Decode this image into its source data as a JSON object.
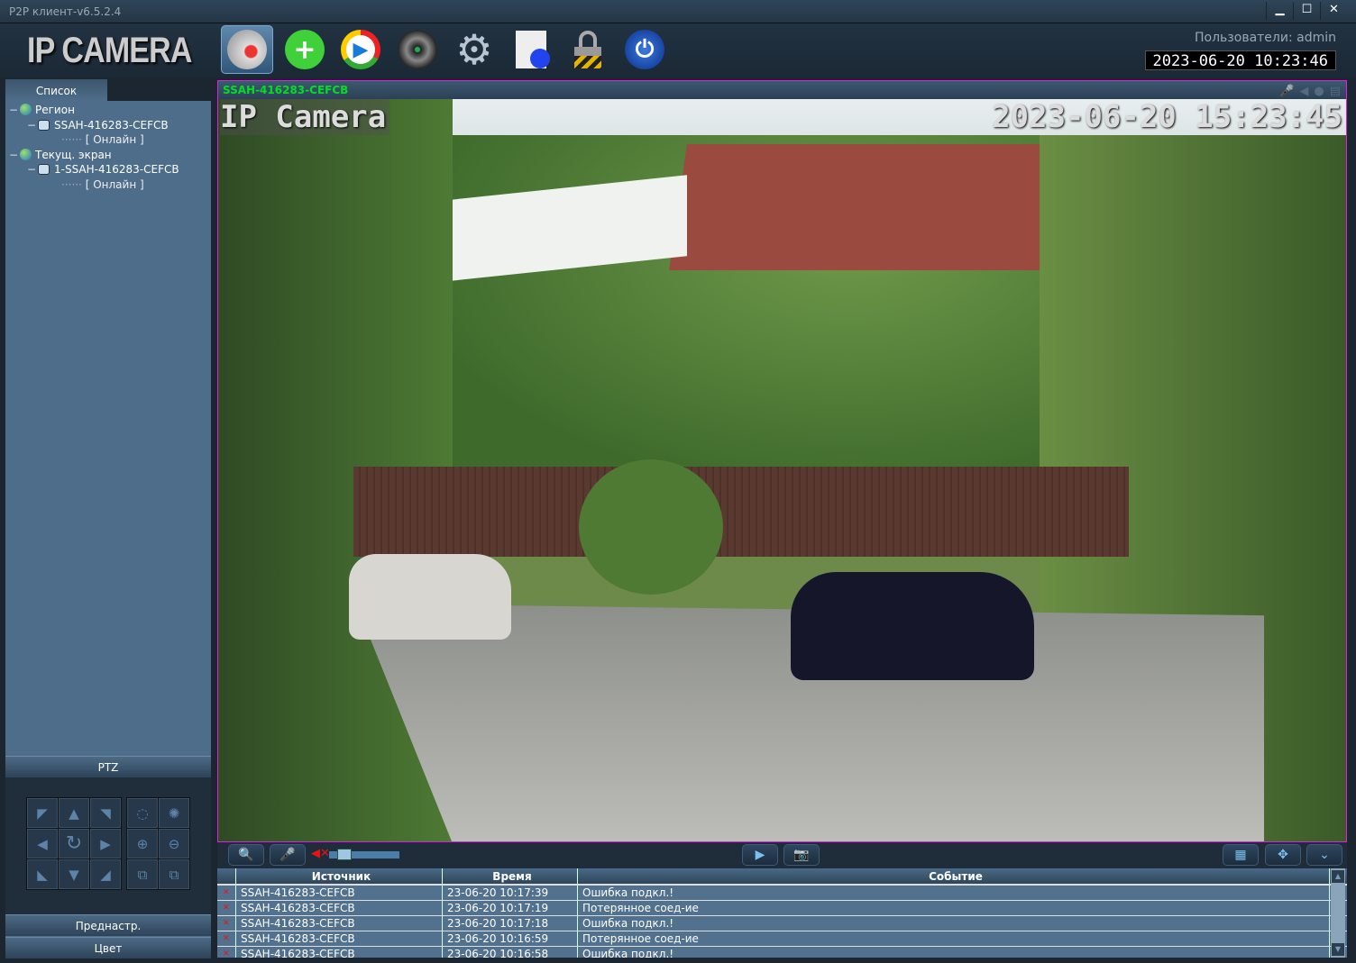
{
  "window": {
    "title": "P2P клиент-v6.5.2.4",
    "controls": [
      "▁",
      "☐",
      "✕"
    ]
  },
  "toolbar": {
    "logo": "IP CAMERA",
    "buttons": [
      {
        "name": "live-view",
        "icon": "webcam-icon"
      },
      {
        "name": "add-device",
        "icon": "plus-icon"
      },
      {
        "name": "playback",
        "icon": "play-icon"
      },
      {
        "name": "ptz-control",
        "icon": "reel-icon"
      },
      {
        "name": "settings",
        "icon": "gear-icon"
      },
      {
        "name": "log",
        "icon": "document-icon"
      },
      {
        "name": "lock",
        "icon": "lock-icon"
      },
      {
        "name": "exit",
        "icon": "power-icon"
      }
    ],
    "user": "Пользователи: admin",
    "clock": "2023-06-20  10:23:46"
  },
  "sidebar": {
    "tab": "Список",
    "tree": [
      {
        "label": "Регион",
        "children": [
          {
            "label": "SSAH-416283-CEFCB",
            "status": "[   Онлайн   ]"
          }
        ]
      },
      {
        "label": "Текущ. экран",
        "children": [
          {
            "label": "1-SSAH-416283-CEFCB",
            "status": "[   Онлайн   ]"
          }
        ]
      }
    ],
    "ptz_label": "PTZ",
    "preset_label": "Преднастр.",
    "color_label": "Цвет"
  },
  "video": {
    "channel": "SSAH-416283-CEFCB",
    "osd_name": "IP Camera",
    "osd_time": "2023-06-20 15:23:45",
    "volume": 0.15
  },
  "events": {
    "columns": [
      "Источник",
      "Время",
      "Событие"
    ],
    "rows": [
      [
        "SSAH-416283-CEFCB",
        "23-06-20 10:17:39",
        "Ошибка подкл.!"
      ],
      [
        "SSAH-416283-CEFCB",
        "23-06-20 10:17:19",
        "Потерянное соед-ие"
      ],
      [
        "SSAH-416283-CEFCB",
        "23-06-20 10:17:18",
        "Ошибка подкл.!"
      ],
      [
        "SSAH-416283-CEFCB",
        "23-06-20 10:16:59",
        "Потерянное соед-ие"
      ],
      [
        "SSAH-416283-CEFCB",
        "23-06-20 10:16:58",
        "Ошибка подкл.!"
      ]
    ]
  }
}
